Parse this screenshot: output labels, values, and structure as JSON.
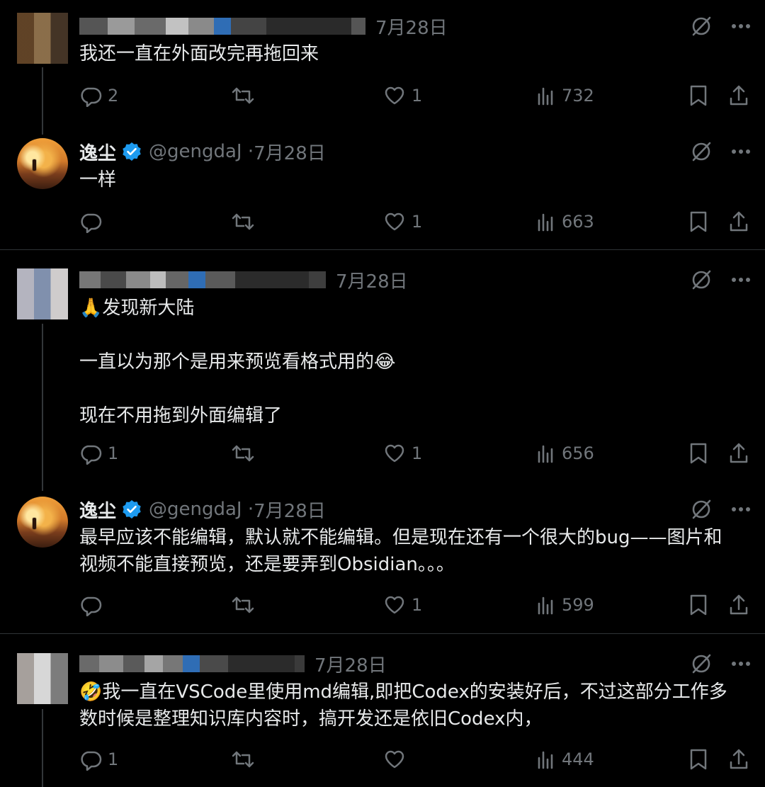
{
  "tweets": [
    {
      "name": "",
      "handle": "",
      "date": "7月28日",
      "text": "我还一直在外面改完再拖回来",
      "replies": "2",
      "retweets": "",
      "likes": "1",
      "views": "732"
    },
    {
      "name": "逸尘",
      "handle": "@gengdaJ · ",
      "date": "7月28日",
      "text": "一样",
      "replies": "",
      "retweets": "",
      "likes": "1",
      "views": "663"
    },
    {
      "name": "",
      "handle": "",
      "date": "7月28日",
      "text": "🙏发现新大陆\n\n一直以为那个是用来预览看格式用的😂\n\n现在不用拖到外面编辑了",
      "replies": "1",
      "retweets": "",
      "likes": "1",
      "views": "656"
    },
    {
      "name": "逸尘",
      "handle": "@gengdaJ · ",
      "date": "7月28日",
      "text": "最早应该不能编辑，默认就不能编辑。但是现在还有一个很大的bug——图片和视频不能直接预览，还是要弄到Obsidian。。。",
      "replies": "",
      "retweets": "",
      "likes": "1",
      "views": "599"
    },
    {
      "name": "",
      "handle": "",
      "date": "7月28日",
      "text": "🤣我一直在VSCode里使用md编辑,即把Codex的安装好后，不过这部分工作多数时候是整理知识库内容时，搞开发还是依旧Codex内，",
      "replies": "1",
      "retweets": "",
      "likes": "",
      "views": "444"
    }
  ],
  "icons": {
    "reply": "reply-icon",
    "retweet": "retweet-icon",
    "like": "like-icon",
    "views": "views-icon",
    "bookmark": "bookmark-icon",
    "share": "share-icon",
    "grok": "grok-icon",
    "more": "more-icon",
    "verified": "verified-badge-icon"
  },
  "colors": {
    "background": "#000000",
    "text": "#e7e9ea",
    "secondary": "#71767b",
    "verified": "#1d9bf0"
  }
}
